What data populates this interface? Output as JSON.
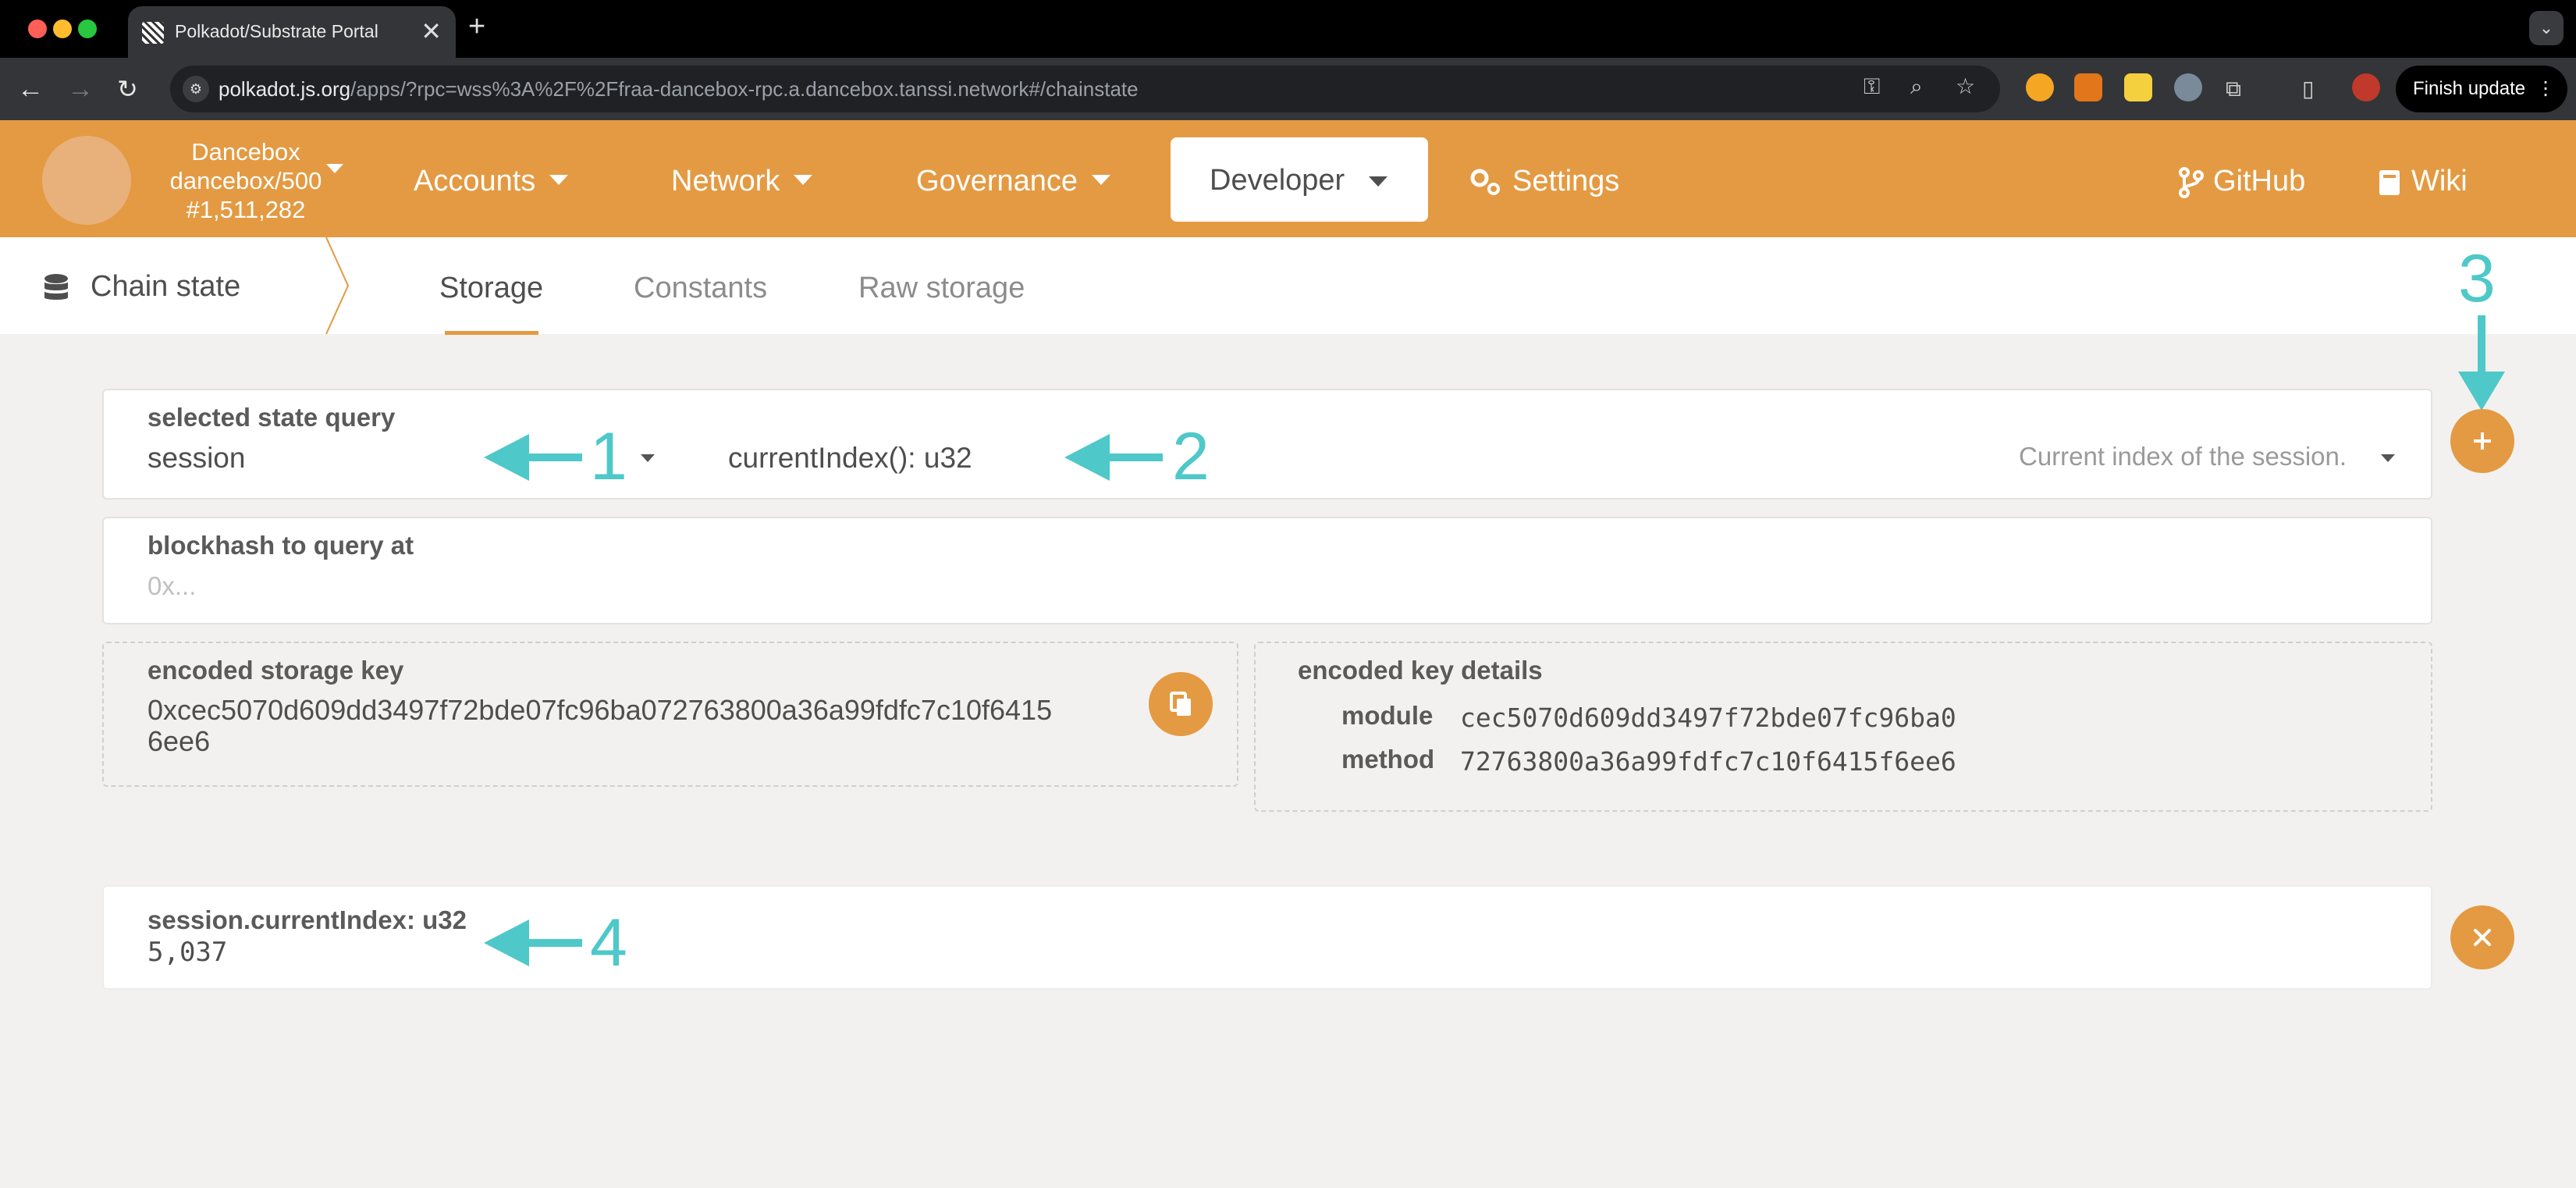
{
  "browser": {
    "tab_title": "Polkadot/Substrate Portal",
    "tab_close": "✕",
    "new_tab": "+",
    "url_host": "polkadot.js.org",
    "url_path": "/apps/?rpc=wss%3A%2F%2Ffraa-dancebox-rpc.a.dancebox.tanssi.network#/chainstate",
    "finish_update": "Finish update",
    "colors": {
      "close": "#ff5f57",
      "minimize": "#febc2e",
      "maximize": "#28c840"
    }
  },
  "header": {
    "chain_name": "Dancebox",
    "chain_runtime": "dancebox/500",
    "chain_block": "#1,511,282",
    "menus": [
      "Accounts",
      "Network",
      "Governance",
      "Developer"
    ],
    "settings_label": "Settings",
    "github_label": "GitHub",
    "wiki_label": "Wiki",
    "accent_color": "#e49a42"
  },
  "subnav": {
    "section_label": "Chain state",
    "tabs": [
      "Storage",
      "Constants",
      "Raw storage"
    ],
    "active_tab": "Storage"
  },
  "query": {
    "selected_label": "selected state query",
    "module": "session",
    "method": "currentIndex(): u32",
    "description": "Current index of the session.",
    "blockhash_label": "blockhash to query at",
    "blockhash_placeholder": "0x...",
    "encoded_key_label": "encoded storage key",
    "encoded_key_line1": "0xcec5070d609dd3497f72bde07fc96ba072763800a36a99fdfc7c10f6415",
    "encoded_key_line2": "6ee6",
    "key_details_label": "encoded key details",
    "module_label": "module",
    "module_value": "cec5070d609dd3497f72bde07fc96ba0",
    "method_label": "method",
    "method_value": "72763800a36a99fdfc7c10f6415f6ee6"
  },
  "result": {
    "label": "session.currentIndex: u32",
    "value": "5,037"
  },
  "annotations": [
    "1",
    "2",
    "3",
    "4"
  ]
}
